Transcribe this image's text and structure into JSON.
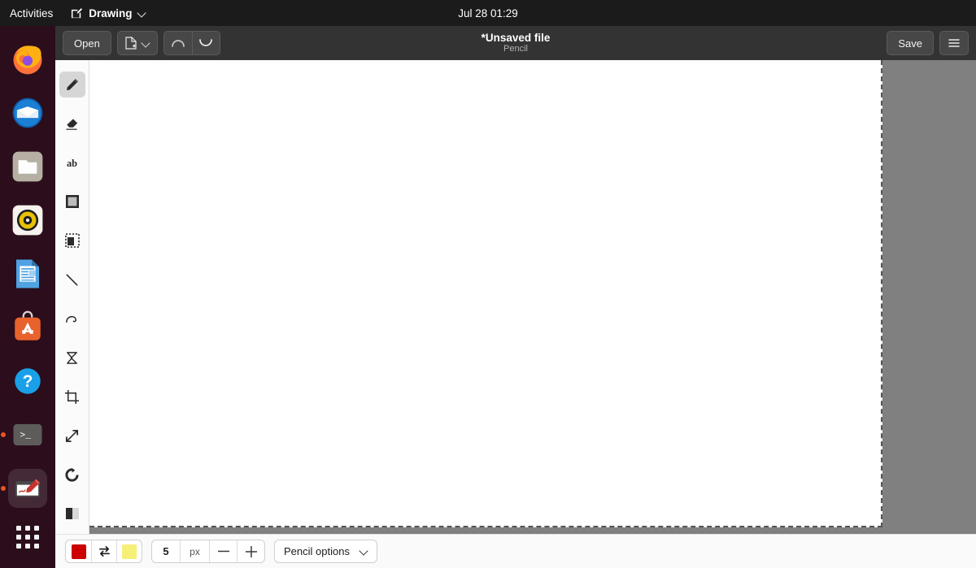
{
  "topbar": {
    "activities": "Activities",
    "app_name": "Drawing",
    "app_icon": "drawing-app-icon",
    "clock": "Jul 28  01:29",
    "chevron_icon": "chevron-down-icon"
  },
  "dock": {
    "items": [
      {
        "name": "firefox",
        "label": "Firefox",
        "running": false,
        "active": false
      },
      {
        "name": "thunderbird",
        "label": "Thunderbird Mail",
        "running": false,
        "active": false
      },
      {
        "name": "files",
        "label": "Files",
        "running": false,
        "active": false
      },
      {
        "name": "rhythmbox",
        "label": "Rhythmbox",
        "running": false,
        "active": false
      },
      {
        "name": "libreoffice-writer",
        "label": "LibreOffice Writer",
        "running": false,
        "active": false
      },
      {
        "name": "ubuntu-software",
        "label": "Ubuntu Software",
        "running": false,
        "active": false
      },
      {
        "name": "help",
        "label": "Help",
        "running": false,
        "active": false
      },
      {
        "name": "terminal",
        "label": "Terminal",
        "running": true,
        "active": false
      },
      {
        "name": "drawing",
        "label": "Drawing",
        "running": true,
        "active": true
      }
    ],
    "show_apps_label": "Show Applications",
    "background": "#2b0d1b",
    "running_dot_color": "#e95420"
  },
  "header": {
    "open_label": "Open",
    "new_image_icon": "new-document-icon",
    "new_image_chevron": "chevron-down-icon",
    "undo_icon": "undo-icon",
    "redo_icon": "redo-icon",
    "title": "*Unsaved file",
    "subtitle": "Pencil",
    "save_label": "Save",
    "menu_icon": "hamburger-menu-icon",
    "background": "#333333"
  },
  "tools": {
    "items": [
      {
        "name": "pencil",
        "label": "Pencil",
        "icon": "pencil-icon",
        "selected": true
      },
      {
        "name": "eraser",
        "label": "Eraser",
        "icon": "eraser-icon",
        "selected": false
      },
      {
        "name": "text",
        "label": "Text",
        "icon": "text-ab-icon",
        "selected": false
      },
      {
        "name": "rectangle",
        "label": "Rectangle",
        "icon": "filled-square-icon",
        "selected": false
      },
      {
        "name": "selection",
        "label": "Selection",
        "icon": "selection-icon",
        "selected": false
      },
      {
        "name": "line",
        "label": "Line",
        "icon": "line-icon",
        "selected": false
      },
      {
        "name": "curve",
        "label": "Curve",
        "icon": "curve-icon",
        "selected": false
      },
      {
        "name": "shape",
        "label": "Shape",
        "icon": "polygon-icon",
        "selected": false
      },
      {
        "name": "crop",
        "label": "Crop",
        "icon": "crop-icon",
        "selected": false
      },
      {
        "name": "scale",
        "label": "Scale",
        "icon": "scale-arrows-icon",
        "selected": false
      },
      {
        "name": "rotate",
        "label": "Rotate",
        "icon": "rotate-icon",
        "selected": false
      },
      {
        "name": "filters",
        "label": "Filters",
        "icon": "contrast-icon",
        "selected": false
      }
    ]
  },
  "canvas": {
    "background": "#ffffff",
    "surround": "#808080",
    "border_style": "dashed"
  },
  "bottombar": {
    "main_color": "#cc0000",
    "secondary_color": "#f6f079",
    "swap_icon": "swap-colors-icon",
    "size_value": "5",
    "size_unit": "px",
    "decrease_icon": "minus-icon",
    "increase_icon": "plus-icon",
    "options_label": "Pencil options",
    "options_chevron": "chevron-down-icon"
  }
}
